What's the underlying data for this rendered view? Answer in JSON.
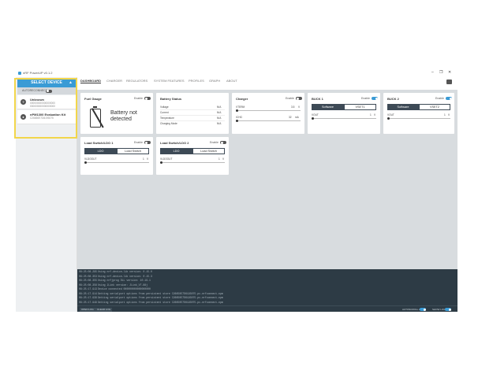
{
  "window": {
    "title": "nRF PowerUP v0.1.2"
  },
  "sidebar": {
    "select_device": "SELECT DEVICE",
    "autoreconnect": "AUTORECONNECT",
    "devices": [
      {
        "badge": "?",
        "name": "Unknown",
        "serial_1": "000000000000000000",
        "serial_2": "000000000000000000"
      },
      {
        "badge": "●",
        "name": "nPM1300 Evaluation Kit",
        "serial_1": "C26650E7D6193075",
        "serial_2": ""
      }
    ]
  },
  "nav": {
    "tabs": [
      "DASHBOARD",
      "CHARGER",
      "REGULATORS",
      "SYSTEM FEATURES",
      "PROFILES",
      "GRAPH",
      "ABOUT"
    ]
  },
  "cards": {
    "fuel_gauge": {
      "title": "Fuel Gauge",
      "enable": "Enable",
      "battery_text_1": "Battery not",
      "battery_text_2": "detected"
    },
    "battery_status": {
      "title": "Battery Status",
      "rows": [
        {
          "label": "Voltage",
          "value": "N/A"
        },
        {
          "label": "Current",
          "value": "N/A"
        },
        {
          "label": "Temperature",
          "value": "N/A"
        },
        {
          "label": "Charging Mode",
          "value": "N/A"
        }
      ]
    },
    "charger": {
      "title": "Charger",
      "enable": "Enable",
      "vterm_label": "VTERM",
      "vterm_value": "3.5",
      "vterm_unit": "V",
      "ichg_label": "ICHG",
      "ichg_value": "32",
      "ichg_unit": "mA"
    },
    "buck1": {
      "title": "BUCK 1",
      "enable": "Enable",
      "seg_software": "Software",
      "seg_vset": "VSET1",
      "vout_label": "VOUT",
      "vout_value": "1",
      "vout_unit": "V"
    },
    "buck2": {
      "title": "BUCK 2",
      "enable": "Enable",
      "seg_software": "Software",
      "seg_vset": "VSET2",
      "vout_label": "VOUT",
      "vout_value": "1",
      "vout_unit": "V"
    },
    "ldo1": {
      "title": "Load Switch/LDO 1",
      "enable": "Enable",
      "seg_ldo": "LDO",
      "seg_switch": "Load Switch",
      "vout_label": "VLDOOUT",
      "vout_value": "1",
      "vout_unit": "V"
    },
    "ldo2": {
      "title": "Load Switch/LDO 2",
      "enable": "Enable",
      "seg_ldo": "LDO",
      "seg_switch": "Load Switch",
      "vout_label": "VLDOOUT",
      "vout_value": "1",
      "vout_unit": "V"
    }
  },
  "log": {
    "lines": [
      {
        "ts": "08:25:08.295",
        "msg": "Using nrf-device-lib version: 0.15.0"
      },
      {
        "ts": "08:25:08.353",
        "msg": "Using nrf-device-lib version: 0.15.3"
      },
      {
        "ts": "08:25:08.355",
        "msg": "Using nrfjprog DLL version: 10.19.1"
      },
      {
        "ts": "08:25:08.356",
        "msg": "Using JLink version: JLink_V7.88j"
      },
      {
        "ts": "08:25:17.913",
        "msg": "Device connected 000000000000000000"
      },
      {
        "ts": "08:25:17.914",
        "msg": "Getting serialport options from persistent store C26650E7D6193075.pc-nrfconnect-npm"
      },
      {
        "ts": "08:25:17.939",
        "msg": "Getting serialport options from persistent store C26650E7D6193075.pc-nrfconnect-npm"
      },
      {
        "ts": "08:25:17.949",
        "msg": "Getting serialport options from persistent store C26650E7D6193075.pc-nrfconnect-npm"
      }
    ]
  },
  "footer": {
    "open_log": "OPEN LOG",
    "clear_log": "CLEAR LOG",
    "autoscroll": "AUTOSCROLL LOG",
    "show_log": "SHOW LOG"
  }
}
